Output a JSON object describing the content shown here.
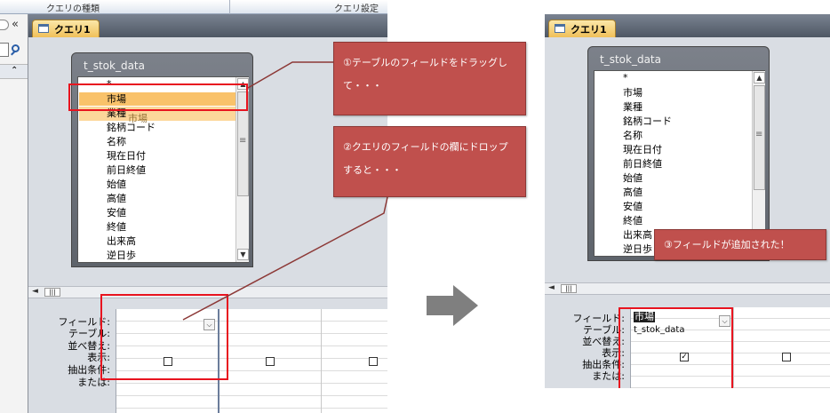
{
  "ribbon": {
    "query_type_label": "クエリの種類",
    "query_settings_label": "クエリ設定",
    "collapse_glyph": "«"
  },
  "doc_tab": {
    "label": "クエリ1"
  },
  "field_list": {
    "title": "t_stok_data",
    "items": [
      "*",
      "市場",
      "業種",
      "銘柄コード",
      "名称",
      "現在日付",
      "前日終値",
      "始値",
      "高値",
      "安値",
      "終値",
      "出来高",
      "逆日歩"
    ],
    "drag_ghost": "市場"
  },
  "grid": {
    "row_labels": [
      "フィールド:",
      "テーブル:",
      "並べ替え:",
      "表示:",
      "抽出条件:",
      "または:"
    ],
    "result_field": "市場",
    "result_table": "t_stok_data"
  },
  "callouts": {
    "step1_line1": "①テーブルのフィールドをドラッグし",
    "step1_line2": "て・・・",
    "step2_line1": "②クエリのフィールドの欄にドロップ",
    "step2_line2": "すると・・・",
    "step3": "③フィールドが追加された！"
  },
  "icons": {
    "scroll_up": "▲",
    "scroll_down": "▼",
    "scroll_grip": "≡",
    "dropdown": "⌵",
    "check": "✓",
    "h_left": "◄",
    "h_grip": "|||",
    "nav_up": "⌃"
  }
}
